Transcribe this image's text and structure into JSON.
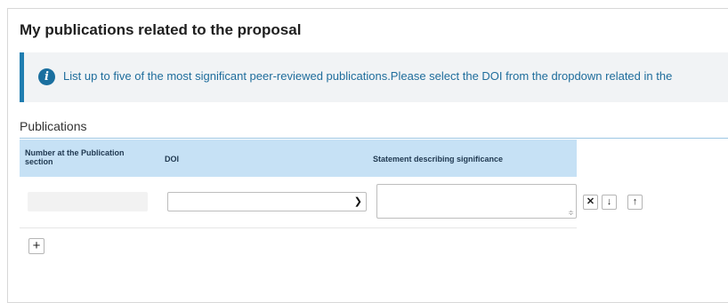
{
  "section": {
    "title": "My publications related to the proposal"
  },
  "info": {
    "icon": "info-circle-icon",
    "text": "List up to five of the most significant peer-reviewed publications.Please select the DOI from the dropdown related in the"
  },
  "publications": {
    "label": "Publications",
    "columns": {
      "number": "Number at the Publication section",
      "doi": "DOI",
      "statement": "Statement describing significance"
    },
    "rows": [
      {
        "number": "",
        "doi": "",
        "statement": ""
      }
    ],
    "row_actions": {
      "remove_icon": "close-icon",
      "down_icon": "arrow-down-icon",
      "up_icon": "arrow-up-icon"
    },
    "add_icon": "plus-icon"
  }
}
